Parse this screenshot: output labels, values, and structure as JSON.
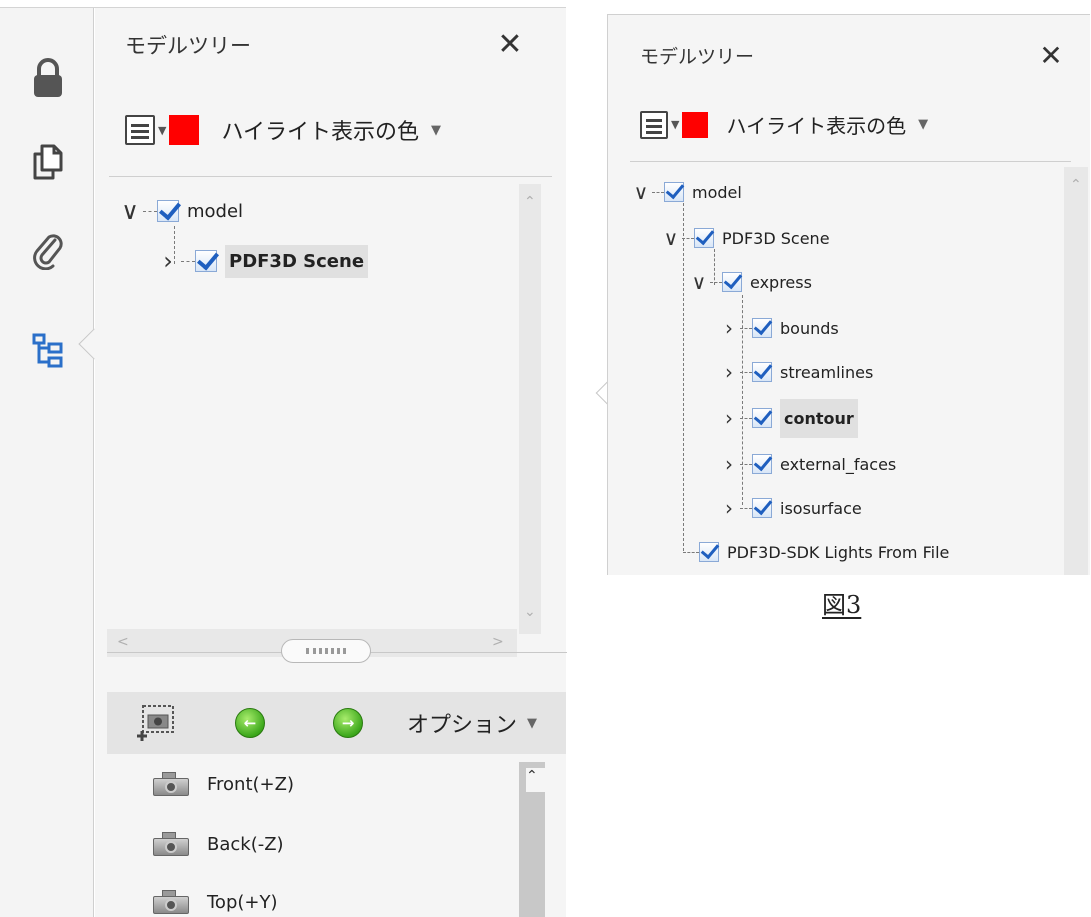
{
  "left_panel": {
    "title": "モデルツリー",
    "close_glyph": "✕",
    "highlight_color_label": "ハイライト表示の色",
    "highlight_color": "#ff0000",
    "tree": [
      {
        "label": "model",
        "expander": "∨"
      },
      {
        "label": "PDF3D Scene",
        "expander": "›"
      }
    ],
    "views_toolbar": {
      "options_label": "オプション"
    },
    "views": [
      {
        "label": "Front(+Z)"
      },
      {
        "label": "Back(-Z)"
      },
      {
        "label": "Top(+Y)"
      }
    ]
  },
  "toolrail": {
    "icons": [
      "lock-icon",
      "pages-icon",
      "attachment-icon",
      "model-tree-icon"
    ],
    "active_color": "#2a6fc9"
  },
  "right_panel": {
    "title": "モデルツリー",
    "close_glyph": "✕",
    "highlight_color_label": "ハイライト表示の色",
    "highlight_color": "#ff0000",
    "tree": [
      {
        "label": "model",
        "expander": "∨"
      },
      {
        "label": "PDF3D Scene",
        "expander": "∨"
      },
      {
        "label": "express",
        "expander": "∨"
      },
      {
        "label": "bounds",
        "expander": "›"
      },
      {
        "label": "streamlines",
        "expander": "›"
      },
      {
        "label": "contour",
        "expander": "›"
      },
      {
        "label": "external_faces",
        "expander": "›"
      },
      {
        "label": "isosurface",
        "expander": "›"
      },
      {
        "label": "PDF3D-SDK Lights From File",
        "expander": ""
      }
    ]
  },
  "caption": "図3"
}
